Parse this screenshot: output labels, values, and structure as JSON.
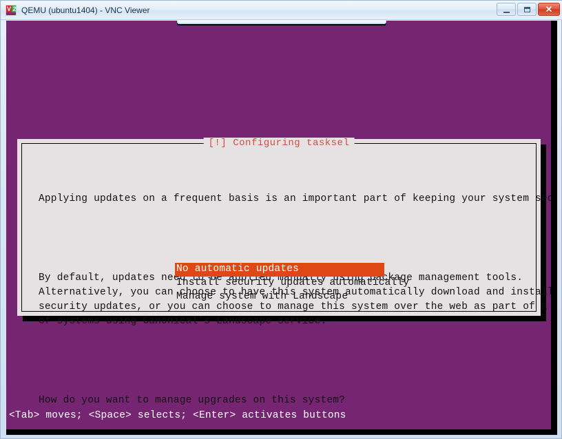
{
  "window": {
    "title": "QEMU (ubuntu1404) - VNC Viewer",
    "icon_name": "vnc-viewer-icon",
    "icon_left_text": "V",
    "icon_right_text": "2",
    "controls": {
      "minimize_label": "–",
      "maximize_label": "□",
      "close_label": "✕"
    }
  },
  "colors": {
    "desktop_purple": "#762572",
    "dialog_background": "#e6e2e4",
    "dialog_title_red": "#d24d41",
    "selection_orange": "#dd4814",
    "text_black": "#111111",
    "help_text_white": "#ffffff"
  },
  "dialog": {
    "title": "[!] Configuring tasksel",
    "paragraphs": [
      "Applying updates on a frequent basis is an important part of keeping your system secure.",
      "By default, updates need to be applied manually using package management tools.\nAlternatively, you can choose to have this system automatically download and install\nsecurity updates, or you can choose to manage this system over the web as part of a group\nof systems using Canonical's Landscape service.",
      "How do you want to manage upgrades on this system?"
    ],
    "menu": {
      "selected_index": 0,
      "options": [
        "No automatic updates",
        "Install security updates automatically",
        "Manage system with Landscape"
      ]
    }
  },
  "status": {
    "help_text": "<Tab> moves; <Space> selects; <Enter> activates buttons"
  }
}
